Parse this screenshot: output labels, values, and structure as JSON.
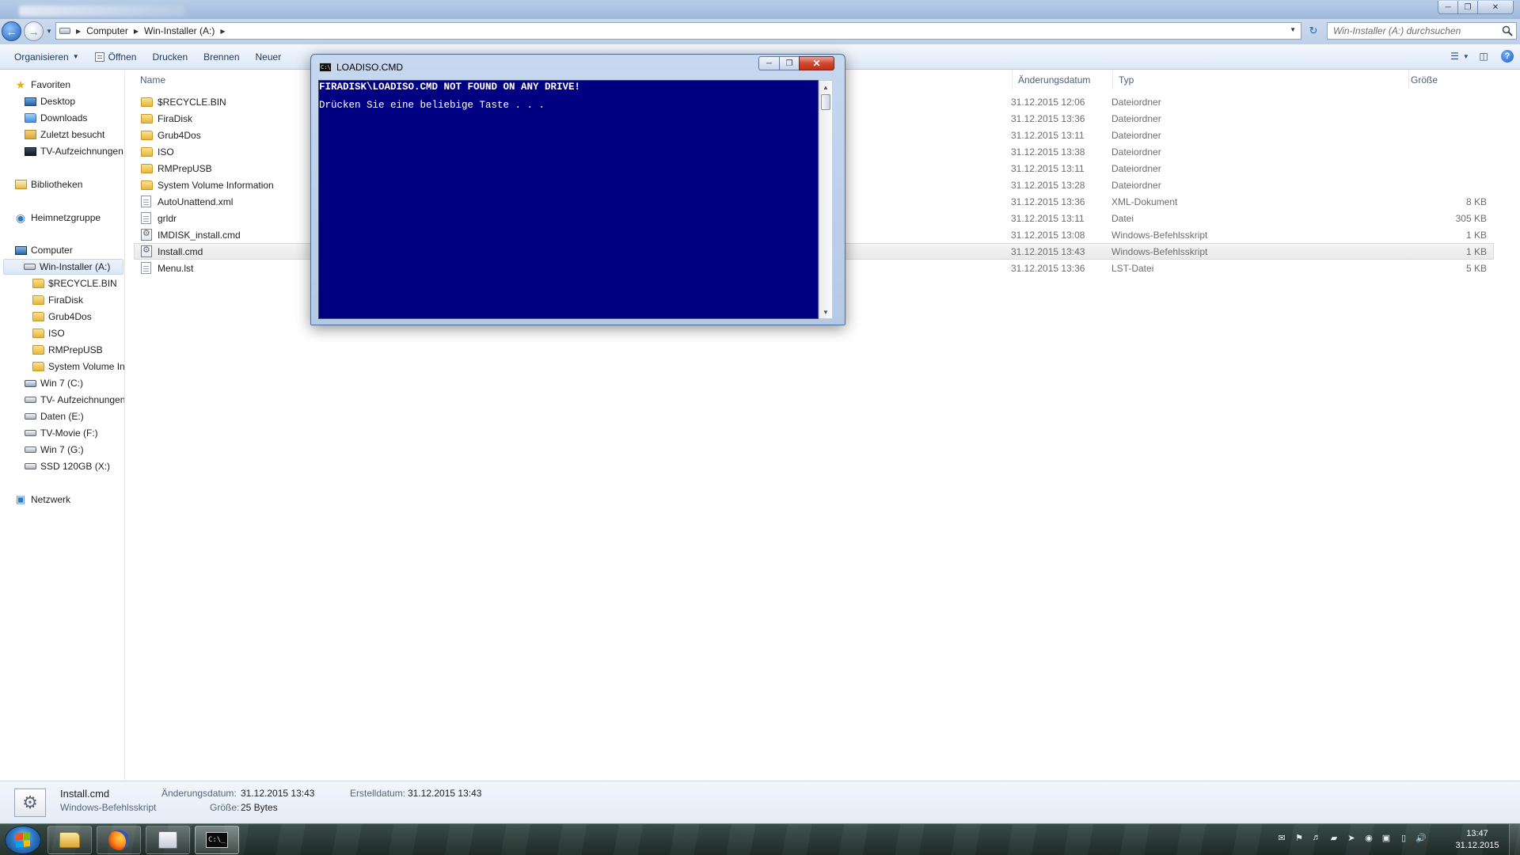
{
  "address": {
    "crumbs": [
      "Computer",
      "Win-Installer (A:)"
    ],
    "search_placeholder": "Win-Installer (A:) durchsuchen"
  },
  "toolbar": {
    "organize": "Organisieren",
    "open": "Öffnen",
    "print": "Drucken",
    "burn": "Brennen",
    "new_folder_partial": "Neuer"
  },
  "nav": {
    "favorites": "Favoriten",
    "desktop": "Desktop",
    "downloads": "Downloads",
    "recent": "Zuletzt besucht",
    "tv_recordings": "TV-Aufzeichnungen",
    "libraries": "Bibliotheken",
    "homegroup": "Heimnetzgruppe",
    "computer": "Computer",
    "drive_a": "Win-Installer (A:)",
    "a_children": [
      "$RECYCLE.BIN",
      "FiraDisk",
      "Grub4Dos",
      "ISO",
      "RMPrepUSB",
      "System Volume In"
    ],
    "drives": [
      "Win 7 (C:)",
      "TV- Aufzeichnungen",
      "Daten (E:)",
      "TV-Movie (F:)",
      "Win 7 (G:)",
      "SSD 120GB (X:)"
    ],
    "network": "Netzwerk"
  },
  "columns": {
    "name": "Name",
    "date": "Änderungsdatum",
    "type": "Typ",
    "size": "Größe"
  },
  "files": [
    {
      "name": "$RECYCLE.BIN",
      "date": "31.12.2015 12:06",
      "type": "Dateiordner",
      "size": "",
      "icon": "folder-icon"
    },
    {
      "name": "FiraDisk",
      "date": "31.12.2015 13:36",
      "type": "Dateiordner",
      "size": "",
      "icon": "folder-icon"
    },
    {
      "name": "Grub4Dos",
      "date": "31.12.2015 13:11",
      "type": "Dateiordner",
      "size": "",
      "icon": "folder-icon"
    },
    {
      "name": "ISO",
      "date": "31.12.2015 13:38",
      "type": "Dateiordner",
      "size": "",
      "icon": "folder-icon"
    },
    {
      "name": "RMPrepUSB",
      "date": "31.12.2015 13:11",
      "type": "Dateiordner",
      "size": "",
      "icon": "folder-icon"
    },
    {
      "name": "System Volume Information",
      "date": "31.12.2015 13:28",
      "type": "Dateiordner",
      "size": "",
      "icon": "folder-icon"
    },
    {
      "name": "AutoUnattend.xml",
      "date": "31.12.2015 13:36",
      "type": "XML-Dokument",
      "size": "8 KB",
      "icon": "document-icon"
    },
    {
      "name": "grldr",
      "date": "31.12.2015 13:11",
      "type": "Datei",
      "size": "305 KB",
      "icon": "document-icon"
    },
    {
      "name": "IMDISK_install.cmd",
      "date": "31.12.2015 13:08",
      "type": "Windows-Befehlsskript",
      "size": "1 KB",
      "icon": "script-icon"
    },
    {
      "name": "Install.cmd",
      "date": "31.12.2015 13:43",
      "type": "Windows-Befehlsskript",
      "size": "1 KB",
      "icon": "script-icon",
      "selected": true
    },
    {
      "name": "Menu.lst",
      "date": "31.12.2015 13:36",
      "type": "LST-Datei",
      "size": "5 KB",
      "icon": "document-icon"
    }
  ],
  "details": {
    "filename": "Install.cmd",
    "filetype": "Windows-Befehlsskript",
    "modified_label": "Änderungsdatum:",
    "modified_value": "31.12.2015 13:43",
    "created_label": "Erstelldatum:",
    "created_value": "31.12.2015 13:43",
    "size_label": "Größe:",
    "size_value": "25 Bytes"
  },
  "console": {
    "title": "LOADISO.CMD",
    "lines": [
      "FIRADISK\\LOADISO.CMD NOT FOUND ON ANY DRIVE!",
      "Drücken Sie eine beliebige Taste . . ."
    ]
  },
  "taskbar": {
    "apps": [
      "explorer-icon",
      "firefox-icon",
      "store-icon",
      "cmd-icon"
    ],
    "cmd_glyph": "C:\\_"
  },
  "clock": {
    "time": "13:47",
    "date": "31.12.2015"
  },
  "colors": {
    "console_bg": "#000080",
    "console_text": "#ffffff",
    "selection": "#e9e9e9"
  }
}
